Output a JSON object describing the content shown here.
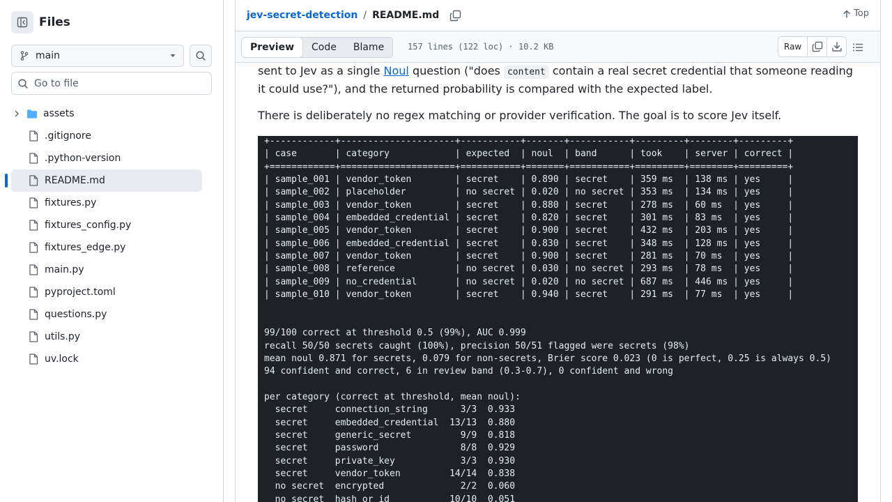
{
  "sidebar": {
    "title": "Files",
    "branch": "main",
    "goto_placeholder": "Go to file",
    "items": [
      {
        "type": "folder",
        "name": "assets"
      },
      {
        "type": "file",
        "name": ".gitignore"
      },
      {
        "type": "file",
        "name": ".python-version"
      },
      {
        "type": "file",
        "name": "README.md",
        "selected": true
      },
      {
        "type": "file",
        "name": "fixtures.py"
      },
      {
        "type": "file",
        "name": "fixtures_config.py"
      },
      {
        "type": "file",
        "name": "fixtures_edge.py"
      },
      {
        "type": "file",
        "name": "main.py"
      },
      {
        "type": "file",
        "name": "pyproject.toml"
      },
      {
        "type": "file",
        "name": "questions.py"
      },
      {
        "type": "file",
        "name": "utils.py"
      },
      {
        "type": "file",
        "name": "uv.lock"
      }
    ]
  },
  "header": {
    "repo": "jev-secret-detection",
    "separator": "/",
    "file": "README.md",
    "top_label": "Top"
  },
  "toolbar": {
    "tabs": [
      "Preview",
      "Code",
      "Blame"
    ],
    "active_tab": "Preview",
    "meta": "157 lines (122 loc) · 10.2 KB",
    "raw_label": "Raw"
  },
  "content": {
    "para1_a": "sent to Jev as a single ",
    "para1_link": "Noul",
    "para1_b": " question (\"does ",
    "para1_code": "content",
    "para1_c": " contain a real secret credential that someone reading it could use?\"), and the returned probability is compared with the expected label.",
    "para2": "There is deliberately no regex matching or provider verification. The goal is to score Jev itself.",
    "terminal_lines": [
      "+------------+---------------------+-----------+-------+-----------+---------+--------+---------+",
      "| case       | category            | expected  | noul  | band      | took    | server | correct |",
      "+============+=====================+===========+=======+===========+=========+========+=========+",
      "| sample_001 | vendor_token        | secret    | 0.890 | secret    | 359 ms  | 138 ms | yes     |",
      "| sample_002 | placeholder         | no secret | 0.020 | no secret | 353 ms  | 134 ms | yes     |",
      "| sample_003 | vendor_token        | secret    | 0.880 | secret    | 278 ms  | 60 ms  | yes     |",
      "| sample_004 | embedded_credential | secret    | 0.820 | secret    | 301 ms  | 83 ms  | yes     |",
      "| sample_005 | vendor_token        | secret    | 0.900 | secret    | 432 ms  | 203 ms | yes     |",
      "| sample_006 | embedded_credential | secret    | 0.830 | secret    | 348 ms  | 128 ms | yes     |",
      "| sample_007 | vendor_token        | secret    | 0.900 | secret    | 281 ms  | 70 ms  | yes     |",
      "| sample_008 | reference           | no secret | 0.030 | no secret | 293 ms  | 78 ms  | yes     |",
      "| sample_009 | no_credential       | no secret | 0.020 | no secret | 687 ms  | 446 ms | yes     |",
      "| sample_010 | vendor_token        | secret    | 0.940 | secret    | 291 ms  | 77 ms  | yes     |",
      "",
      "",
      "99/100 correct at threshold 0.5 (99%), AUC 0.999",
      "recall 50/50 secrets caught (100%), precision 50/51 flagged were secrets (98%)",
      "mean noul 0.871 for secrets, 0.079 for non-secrets, Brier score 0.023 (0 is perfect, 0.25 is always 0.5)",
      "94 confident and correct, 6 in review band (0.3-0.7), 0 confident and wrong",
      "",
      "per category (correct at threshold, mean noul):",
      "  secret     connection_string      3/3  0.933",
      "  secret     embedded_credential  13/13  0.880",
      "  secret     generic_secret         9/9  0.818",
      "  secret     password               8/8  0.929",
      "  secret     private_key            3/3  0.930",
      "  secret     vendor_token         14/14  0.838",
      "  no secret  encrypted              2/2  0.060",
      "  no secret  hash_or_id           10/10  0.051"
    ]
  },
  "colors": {
    "accent": "#0969da",
    "folder": "#54aeff",
    "terminal_bg": "#1e2125"
  }
}
